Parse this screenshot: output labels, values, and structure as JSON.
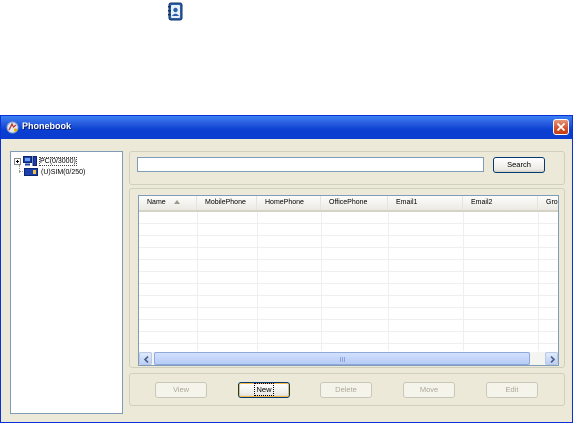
{
  "desktop": {
    "icon": "contacts-book-icon"
  },
  "window": {
    "title": "Phonebook",
    "title_icon": "phonebook-app-icon",
    "close_icon": "close-icon",
    "colors": {
      "titlebar": "#0a3fd0",
      "face": "#ece9d8",
      "close": "#d2502b"
    }
  },
  "tree": {
    "items": [
      {
        "label": "PC(0/3000)",
        "icon": "pc-icon",
        "expandable": true
      },
      {
        "label": "(U)SIM(0/250)",
        "icon": "sim-card-icon",
        "expandable": false
      }
    ]
  },
  "search": {
    "value": "",
    "placeholder": "",
    "button_label": "Search"
  },
  "grid": {
    "columns": [
      "Name",
      "MobilePhone",
      "HomePhone",
      "OfficePhone",
      "Email1",
      "Email2",
      "Grou"
    ],
    "sort_column": "Name",
    "sort_direction": "ascending",
    "rows": []
  },
  "actions": {
    "view": "View",
    "new": "New",
    "delete": "Delete",
    "move": "Move",
    "edit": "Edit"
  }
}
